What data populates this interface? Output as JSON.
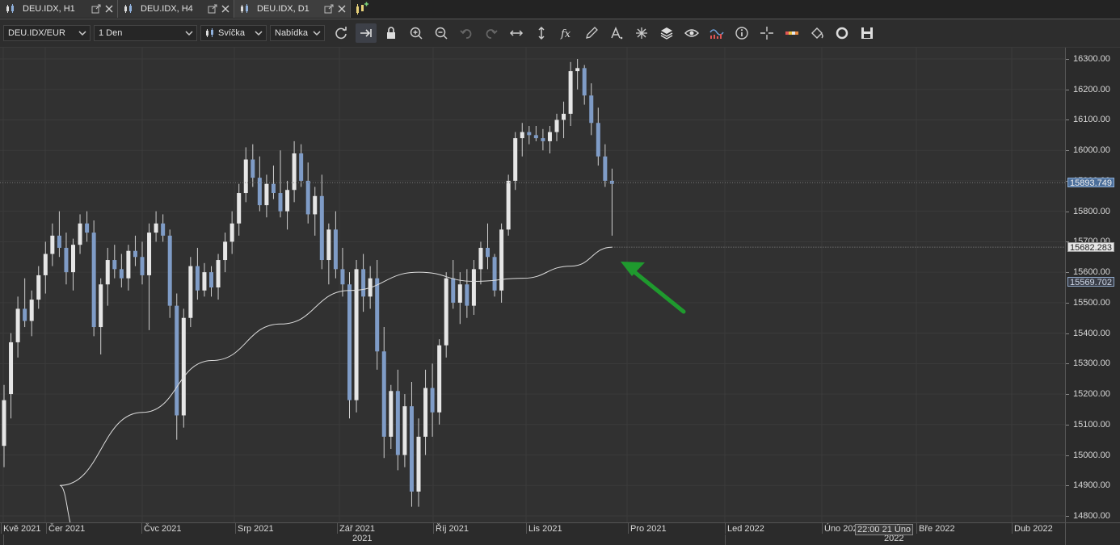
{
  "tabs": [
    {
      "label": "DEU.IDX, H1",
      "active": false
    },
    {
      "label": "DEU.IDX, H4",
      "active": false
    },
    {
      "label": "DEU.IDX, D1",
      "active": true
    }
  ],
  "toolbar": {
    "instrument": "DEU.IDX/EUR",
    "period": "1 Den",
    "chart_type": "Svíčka",
    "side": "Nabídka",
    "tools": [
      "refresh-icon",
      "shift-chart-icon",
      "lock-icon",
      "zoom-in-icon",
      "zoom-out-icon",
      "undo-icon",
      "redo-icon",
      "horizontal-stretch-icon",
      "vertical-stretch-icon",
      "formula-icon",
      "pencil-icon",
      "text-tool-icon",
      "drawing-objects-icon",
      "layers-icon",
      "eye-icon",
      "indicator-icon",
      "info-icon",
      "crosshair-icon",
      "color-bar-icon",
      "paint-bucket-icon",
      "circle-icon",
      "save-icon"
    ]
  },
  "price_axis": {
    "ticks": [
      "16300.00",
      "16200.00",
      "16100.00",
      "16000.00",
      "15900.00",
      "15800.00",
      "15700.00",
      "15600.00",
      "15500.00",
      "15400.00",
      "15300.00",
      "15200.00",
      "15100.00",
      "15000.00",
      "14900.00",
      "14800.00"
    ],
    "tags": {
      "last": "15893.749",
      "ma": "15682.283",
      "low": "15569.702"
    }
  },
  "time_axis": {
    "months": [
      {
        "label": "Kvě 2021"
      },
      {
        "label": "Čer 2021"
      },
      {
        "label": "Čvc 2021"
      },
      {
        "label": "Srp 2021"
      },
      {
        "label": "Zář 2021"
      },
      {
        "label": "Říj 2021"
      },
      {
        "label": "Lis 2021"
      },
      {
        "label": "Pro 2021"
      },
      {
        "label": "Led 2022"
      },
      {
        "label": "Úno 2022"
      },
      {
        "label": "Bře 2022"
      },
      {
        "label": "Dub 2022"
      }
    ],
    "years": [
      "2021",
      "2022"
    ],
    "crosshair_time": "22:00 21 Úno"
  },
  "colors": {
    "bull": "#e6e6e6",
    "bear": "#7f9cc7",
    "ma": "#dddddd",
    "arrow": "#1f9a2e",
    "background": "#313131"
  },
  "chart_data": {
    "type": "candlestick",
    "symbol": "DEU.IDX",
    "timeframe": "D1",
    "ylim": [
      14800,
      16300
    ],
    "candles": [
      [
        15030,
        15230,
        14960,
        15180
      ],
      [
        15200,
        15400,
        15120,
        15370
      ],
      [
        15370,
        15520,
        15320,
        15480
      ],
      [
        15480,
        15580,
        15420,
        15440
      ],
      [
        15440,
        15540,
        15390,
        15510
      ],
      [
        15510,
        15620,
        15480,
        15590
      ],
      [
        15590,
        15700,
        15530,
        15660
      ],
      [
        15660,
        15760,
        15620,
        15720
      ],
      [
        15720,
        15800,
        15650,
        15680
      ],
      [
        15680,
        15730,
        15560,
        15600
      ],
      [
        15600,
        15710,
        15540,
        15690
      ],
      [
        15690,
        15790,
        15660,
        15760
      ],
      [
        15760,
        15800,
        15700,
        15730
      ],
      [
        15730,
        15770,
        15390,
        15420
      ],
      [
        15420,
        15580,
        15330,
        15560
      ],
      [
        15560,
        15680,
        15490,
        15640
      ],
      [
        15640,
        15690,
        15580,
        15610
      ],
      [
        15610,
        15660,
        15550,
        15580
      ],
      [
        15580,
        15690,
        15540,
        15670
      ],
      [
        15670,
        15720,
        15620,
        15650
      ],
      [
        15650,
        15700,
        15560,
        15590
      ],
      [
        15590,
        15760,
        15410,
        15730
      ],
      [
        15730,
        15800,
        15700,
        15760
      ],
      [
        15760,
        15790,
        15700,
        15720
      ],
      [
        15720,
        15740,
        15450,
        15490
      ],
      [
        15490,
        15530,
        15050,
        15130
      ],
      [
        15130,
        15480,
        15090,
        15450
      ],
      [
        15450,
        15650,
        15420,
        15620
      ],
      [
        15620,
        15680,
        15510,
        15540
      ],
      [
        15540,
        15630,
        15520,
        15600
      ],
      [
        15600,
        15620,
        15520,
        15550
      ],
      [
        15550,
        15660,
        15510,
        15640
      ],
      [
        15640,
        15730,
        15600,
        15700
      ],
      [
        15700,
        15800,
        15660,
        15760
      ],
      [
        15760,
        15890,
        15720,
        15860
      ],
      [
        15860,
        16010,
        15830,
        15970
      ],
      [
        15970,
        16020,
        15880,
        15910
      ],
      [
        15910,
        15980,
        15800,
        15820
      ],
      [
        15820,
        15920,
        15780,
        15890
      ],
      [
        15890,
        15950,
        15840,
        15860
      ],
      [
        15860,
        16000,
        15780,
        15800
      ],
      [
        15800,
        15900,
        15740,
        15870
      ],
      [
        15870,
        16030,
        15830,
        15990
      ],
      [
        15990,
        16020,
        15880,
        15900
      ],
      [
        15900,
        15960,
        15760,
        15790
      ],
      [
        15790,
        15880,
        15720,
        15850
      ],
      [
        15850,
        15920,
        15610,
        15640
      ],
      [
        15640,
        15760,
        15560,
        15740
      ],
      [
        15740,
        15800,
        15580,
        15610
      ],
      [
        15610,
        15680,
        15520,
        15560
      ],
      [
        15560,
        15600,
        15120,
        15180
      ],
      [
        15180,
        15640,
        15140,
        15610
      ],
      [
        15610,
        15660,
        15470,
        15520
      ],
      [
        15520,
        15620,
        15480,
        15580
      ],
      [
        15580,
        15640,
        15280,
        15340
      ],
      [
        15340,
        15420,
        14990,
        15060
      ],
      [
        15060,
        15230,
        15020,
        15210
      ],
      [
        15210,
        15280,
        14950,
        15000
      ],
      [
        15000,
        15200,
        14960,
        15160
      ],
      [
        15160,
        15240,
        14830,
        14880
      ],
      [
        14880,
        15120,
        14830,
        15060
      ],
      [
        15060,
        15280,
        15000,
        15220
      ],
      [
        15220,
        15300,
        15060,
        15140
      ],
      [
        15140,
        15380,
        15100,
        15360
      ],
      [
        15360,
        15600,
        15320,
        15580
      ],
      [
        15580,
        15640,
        15480,
        15500
      ],
      [
        15500,
        15600,
        15430,
        15560
      ],
      [
        15560,
        15610,
        15450,
        15490
      ],
      [
        15490,
        15640,
        15460,
        15610
      ],
      [
        15610,
        15700,
        15560,
        15680
      ],
      [
        15680,
        15760,
        15610,
        15650
      ],
      [
        15650,
        15660,
        15520,
        15540
      ],
      [
        15540,
        15760,
        15500,
        15740
      ],
      [
        15740,
        15920,
        15720,
        15900
      ],
      [
        15900,
        16060,
        15870,
        16040
      ],
      [
        16040,
        16090,
        15980,
        16060
      ],
      [
        16060,
        16080,
        16020,
        16050
      ],
      [
        16050,
        16080,
        16030,
        16040
      ],
      [
        16040,
        16070,
        16000,
        16030
      ],
      [
        16030,
        16080,
        15990,
        16060
      ],
      [
        16060,
        16120,
        16030,
        16100
      ],
      [
        16100,
        16160,
        16040,
        16120
      ],
      [
        16120,
        16290,
        16080,
        16260
      ],
      [
        16260,
        16300,
        16200,
        16270
      ],
      [
        16270,
        16280,
        16150,
        16180
      ],
      [
        16180,
        16220,
        16050,
        16090
      ],
      [
        16090,
        16140,
        15950,
        15980
      ],
      [
        15980,
        16020,
        15880,
        15900
      ],
      [
        15900,
        15940,
        15720,
        15890
      ]
    ],
    "ma_label": "15682.283",
    "ma_start": 14750,
    "ma_end": 15682.283
  }
}
